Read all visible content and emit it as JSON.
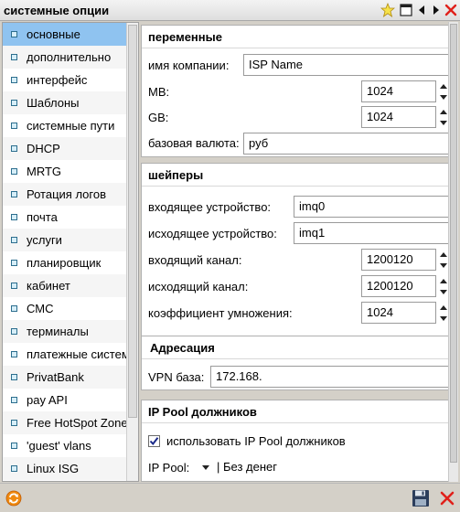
{
  "window": {
    "title": "системные опции"
  },
  "sidebar": {
    "items": [
      {
        "label": "основные"
      },
      {
        "label": "дополнительно"
      },
      {
        "label": "интерфейс"
      },
      {
        "label": "Шаблоны"
      },
      {
        "label": "системные пути"
      },
      {
        "label": "DHCP"
      },
      {
        "label": "MRTG"
      },
      {
        "label": "Ротация логов"
      },
      {
        "label": "почта"
      },
      {
        "label": "услуги"
      },
      {
        "label": "планировщик"
      },
      {
        "label": "кабинет"
      },
      {
        "label": "СМС"
      },
      {
        "label": "терминалы"
      },
      {
        "label": "платежные систем"
      },
      {
        "label": "PrivatBank"
      },
      {
        "label": "pay API"
      },
      {
        "label": "Free HotSpot Zone"
      },
      {
        "label": "'guest' vlans"
      },
      {
        "label": "Linux ISG"
      }
    ],
    "selected_index": 0
  },
  "variables": {
    "title": "переменные",
    "company_label": "имя компании:",
    "company_value": "ISP Name",
    "mb_label": "MB:",
    "mb_value": "1024",
    "gb_label": "GB:",
    "gb_value": "1024",
    "currency_label": "базовая валюта:",
    "currency_value": "руб"
  },
  "shapers": {
    "title": "шейперы",
    "in_device_label": "входящее устройство:",
    "in_device_value": "imq0",
    "out_device_label": "исходящее устройство:",
    "out_device_value": "imq1",
    "in_channel_label": "входящий канал:",
    "in_channel_value": "1200120",
    "out_channel_label": "исходящий канал:",
    "out_channel_value": "1200120",
    "multiplier_label": "коэффициент умножения:",
    "multiplier_value": "1024"
  },
  "addressing": {
    "title": "Адресация",
    "vpn_label": "VPN база:",
    "vpn_value": "172.168."
  },
  "debtors_pool": {
    "title": "IP Pool должников",
    "use_label": "использовать IP Pool должников",
    "use_checked": true,
    "pool_label": "IP Pool:",
    "pool_value": "| Без денег"
  },
  "icons": {
    "favorite": "star-icon",
    "maximize": "window-icon",
    "prev": "arrow-left-icon",
    "next": "arrow-right-icon",
    "close": "close-icon",
    "refresh": "refresh-icon",
    "save": "save-icon",
    "cancel": "cancel-icon"
  },
  "colors": {
    "selected": "#8fc3f0",
    "close": "#e0201a",
    "refresh": "#f08a10"
  }
}
